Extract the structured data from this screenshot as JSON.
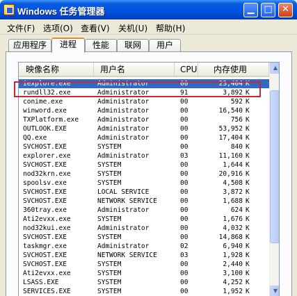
{
  "window": {
    "title": "Windows 任务管理器",
    "controls": [
      "minimize-icon",
      "maximize-icon",
      "close-icon"
    ]
  },
  "menu": [
    {
      "label": "文件(F)"
    },
    {
      "label": "选项(O)"
    },
    {
      "label": "查看(V)"
    },
    {
      "label": "关机(U)"
    },
    {
      "label": "帮助(H)"
    }
  ],
  "tabs": [
    {
      "label": "应用程序",
      "active": false
    },
    {
      "label": "进程",
      "active": true
    },
    {
      "label": "性能",
      "active": false
    },
    {
      "label": "联网",
      "active": false
    },
    {
      "label": "用户",
      "active": false
    }
  ],
  "columns": {
    "name": "映像名称",
    "user": "用户名",
    "cpu": "CPU",
    "mem": "内存使用"
  },
  "processes": [
    {
      "name": "iexplore.exe",
      "user": "Administrator",
      "cpu": "00",
      "mem": "23,404",
      "unit": "K",
      "selected": true
    },
    {
      "name": "rundll32.exe",
      "user": "Administrator",
      "cpu": "91",
      "mem": "3,892",
      "unit": "K"
    },
    {
      "name": "conime.exe",
      "user": "Administrator",
      "cpu": "00",
      "mem": "592",
      "unit": "K"
    },
    {
      "name": "winword.exe",
      "user": "Administrator",
      "cpu": "00",
      "mem": "16,540",
      "unit": "K"
    },
    {
      "name": "TXPlatform.exe",
      "user": "Administrator",
      "cpu": "00",
      "mem": "756",
      "unit": "K"
    },
    {
      "name": "OUTLOOK.EXE",
      "user": "Administrator",
      "cpu": "00",
      "mem": "53,952",
      "unit": "K"
    },
    {
      "name": "QQ.exe",
      "user": "Administrator",
      "cpu": "00",
      "mem": "17,404",
      "unit": "K"
    },
    {
      "name": "SVCHOST.EXE",
      "user": "SYSTEM",
      "cpu": "00",
      "mem": "840",
      "unit": "K"
    },
    {
      "name": "explorer.exe",
      "user": "Administrator",
      "cpu": "03",
      "mem": "11,160",
      "unit": "K"
    },
    {
      "name": "SVCHOST.EXE",
      "user": "SYSTEM",
      "cpu": "00",
      "mem": "1,644",
      "unit": "K"
    },
    {
      "name": "nod32krn.exe",
      "user": "SYSTEM",
      "cpu": "00",
      "mem": "20,916",
      "unit": "K"
    },
    {
      "name": "spoolsv.exe",
      "user": "SYSTEM",
      "cpu": "00",
      "mem": "4,508",
      "unit": "K"
    },
    {
      "name": "SVCHOST.EXE",
      "user": "LOCAL SERVICE",
      "cpu": "00",
      "mem": "3,872",
      "unit": "K"
    },
    {
      "name": "SVCHOST.EXE",
      "user": "NETWORK SERVICE",
      "cpu": "00",
      "mem": "1,688",
      "unit": "K"
    },
    {
      "name": "360tray.exe",
      "user": "Administrator",
      "cpu": "00",
      "mem": "624",
      "unit": "K"
    },
    {
      "name": "Ati2evxx.exe",
      "user": "SYSTEM",
      "cpu": "00",
      "mem": "1,676",
      "unit": "K"
    },
    {
      "name": "nod32kui.exe",
      "user": "Administrator",
      "cpu": "00",
      "mem": "4,032",
      "unit": "K"
    },
    {
      "name": "SVCHOST.EXE",
      "user": "SYSTEM",
      "cpu": "00",
      "mem": "14,868",
      "unit": "K"
    },
    {
      "name": "taskmgr.exe",
      "user": "Administrator",
      "cpu": "02",
      "mem": "6,940",
      "unit": "K"
    },
    {
      "name": "SVCHOST.EXE",
      "user": "NETWORK SERVICE",
      "cpu": "03",
      "mem": "1,928",
      "unit": "K"
    },
    {
      "name": "SVCHOST.EXE",
      "user": "SYSTEM",
      "cpu": "00",
      "mem": "2,440",
      "unit": "K"
    },
    {
      "name": "Ati2evxx.exe",
      "user": "SYSTEM",
      "cpu": "00",
      "mem": "3,100",
      "unit": "K"
    },
    {
      "name": "LSASS.EXE",
      "user": "SYSTEM",
      "cpu": "00",
      "mem": "4,252",
      "unit": "K"
    },
    {
      "name": "SERVICES.EXE",
      "user": "SYSTEM",
      "cpu": "00",
      "mem": "1,952",
      "unit": "K"
    }
  ],
  "colors": {
    "selection": "#316ac5",
    "highlight_box": "#c8282b",
    "titlebar": "#0055e5"
  }
}
